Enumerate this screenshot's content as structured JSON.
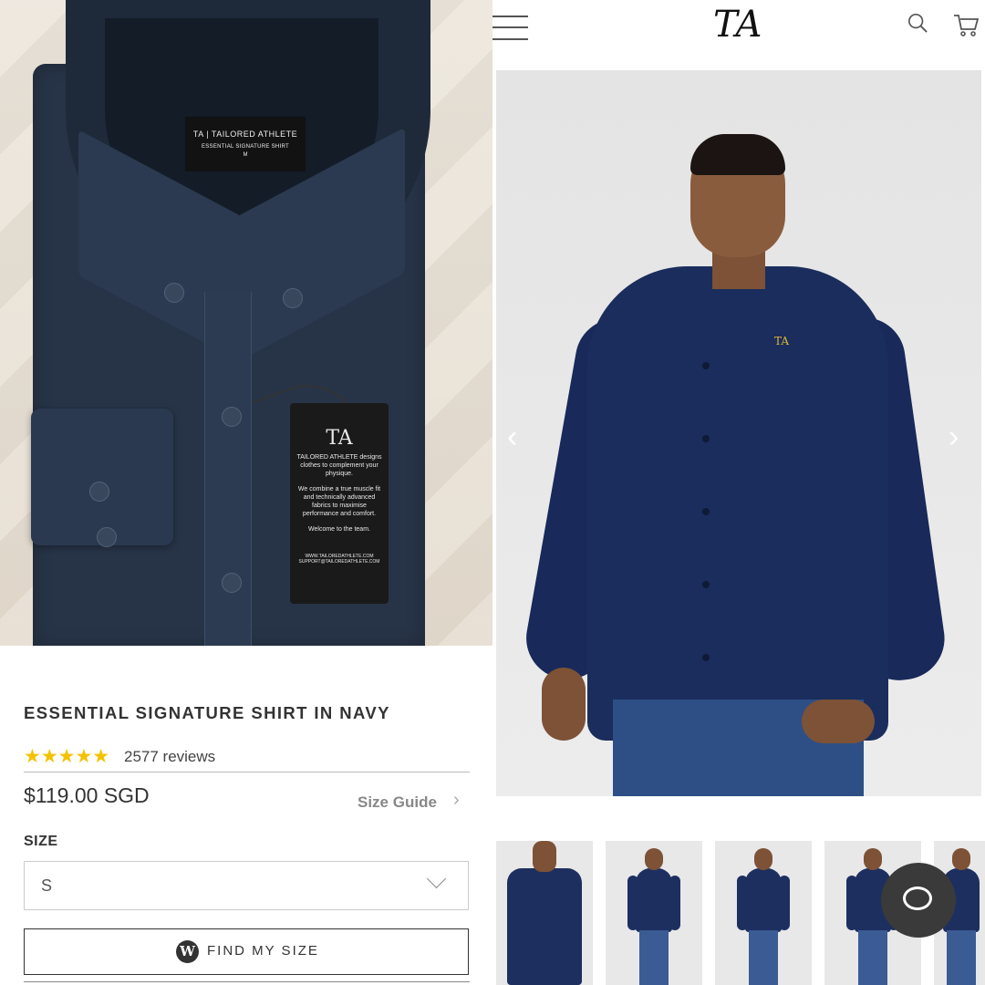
{
  "photo_left": {
    "label_tag": {
      "brand": "TAILORED ATHLETE",
      "product": "ESSENTIAL SIGNATURE SHIRT",
      "size": "M",
      "logo": "TA"
    },
    "hang_tag": {
      "logo": "TA",
      "paragraph1": "TAILORED ATHLETE designs clothes to complement your physique.",
      "paragraph2": "We combine a true muscle fit and technically advanced fabrics to maximise performance and comfort.",
      "paragraph3": "Welcome to the team.",
      "url": "WWW.TAILOREDATHLETE.COM",
      "email": "SUPPORT@TAILOREDATHLETE.COM"
    }
  },
  "product": {
    "title": "ESSENTIAL SIGNATURE SHIRT IN NAVY",
    "stars": "★★★★★",
    "rating": 5,
    "reviews": "2577 reviews",
    "price": "$119.00 SGD",
    "size_guide": "Size Guide",
    "size_label": "SIZE",
    "size_selected": "S",
    "find_size_label": "FIND MY SIZE",
    "find_size_icon": "W"
  },
  "header": {
    "menu_icon": "hamburger-icon",
    "logo": "TA",
    "search_icon": "search-icon",
    "cart_icon": "cart-icon"
  },
  "gallery": {
    "model_logo": "TA",
    "prev": "‹",
    "next": "›",
    "thumbnail_count": 5
  },
  "chat": {
    "icon": "chat-bubble-icon"
  },
  "colors": {
    "navy": "#1a2d5c",
    "star": "#f3c200",
    "text": "#333333"
  }
}
